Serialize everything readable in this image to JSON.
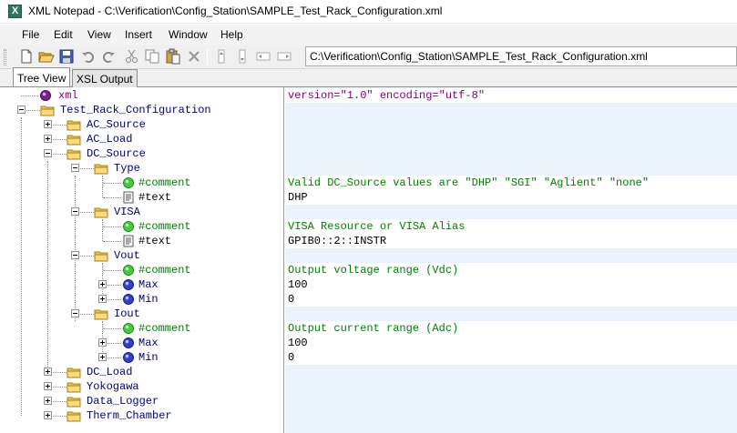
{
  "window": {
    "title": "XML Notepad - C:\\Verification\\Config_Station\\SAMPLE_Test_Rack_Configuration.xml",
    "icon_glyph": "X"
  },
  "menu": [
    "File",
    "Edit",
    "View",
    "Insert",
    "Window",
    "Help"
  ],
  "toolbar": {
    "location": "C:\\Verification\\Config_Station\\SAMPLE_Test_Rack_Configuration.xml",
    "icons": [
      "new-icon",
      "open-icon",
      "save-icon",
      "undo-icon",
      "redo-icon",
      "cut-icon",
      "copy-icon",
      "paste-icon",
      "delete-icon",
      "nudge-up-icon",
      "nudge-down-icon",
      "nudge-left-icon",
      "nudge-right-icon"
    ]
  },
  "tabs": [
    "Tree View",
    "XSL Output"
  ],
  "tree": [
    {
      "label": "xml",
      "kind": "pi",
      "value": "version=\"1.0\" encoding=\"utf-8\""
    },
    {
      "label": "Test_Rack_Configuration",
      "kind": "folder",
      "expander": "minus",
      "value": ""
    },
    {
      "label": "AC_Source",
      "kind": "folder",
      "expander": "plus",
      "value": ""
    },
    {
      "label": "AC_Load",
      "kind": "folder",
      "expander": "plus",
      "value": ""
    },
    {
      "label": "DC_Source",
      "kind": "folder",
      "expander": "minus",
      "value": ""
    },
    {
      "label": "Type",
      "kind": "folder",
      "expander": "minus",
      "value": ""
    },
    {
      "label": "#comment",
      "kind": "comment",
      "value": "Valid DC_Source values are \"DHP\" \"SGI\" \"Aglient\" \"none\""
    },
    {
      "label": "#text",
      "kind": "text",
      "value": "DHP"
    },
    {
      "label": "VISA",
      "kind": "folder",
      "expander": "minus",
      "value": ""
    },
    {
      "label": "#comment",
      "kind": "comment",
      "value": "VISA Resource or VISA Alias"
    },
    {
      "label": "#text",
      "kind": "text",
      "value": "GPIB0::2::INSTR"
    },
    {
      "label": "Vout",
      "kind": "folder",
      "expander": "minus",
      "value": ""
    },
    {
      "label": "#comment",
      "kind": "comment",
      "value": "Output voltage range (Vdc)"
    },
    {
      "label": "Max",
      "kind": "attr",
      "expander": "plus",
      "value": "100"
    },
    {
      "label": "Min",
      "kind": "attr",
      "expander": "plus",
      "value": "0"
    },
    {
      "label": "Iout",
      "kind": "folder",
      "expander": "minus",
      "value": ""
    },
    {
      "label": "#comment",
      "kind": "comment",
      "value": "Output current range (Adc)"
    },
    {
      "label": "Max",
      "kind": "attr",
      "expander": "plus",
      "value": "100"
    },
    {
      "label": "Min",
      "kind": "attr",
      "expander": "plus",
      "value": "0"
    },
    {
      "label": "DC_Load",
      "kind": "folder",
      "expander": "plus",
      "value": ""
    },
    {
      "label": "Yokogawa",
      "kind": "folder",
      "expander": "plus",
      "value": ""
    },
    {
      "label": "Data_Logger",
      "kind": "folder",
      "expander": "plus",
      "value": ""
    },
    {
      "label": "Therm_Chamber",
      "kind": "folder",
      "expander": "plus",
      "value": ""
    }
  ],
  "colors": {
    "element": "#000080",
    "comment": "#008000",
    "pi": "#800080",
    "value_background": "#eaf2fb"
  }
}
